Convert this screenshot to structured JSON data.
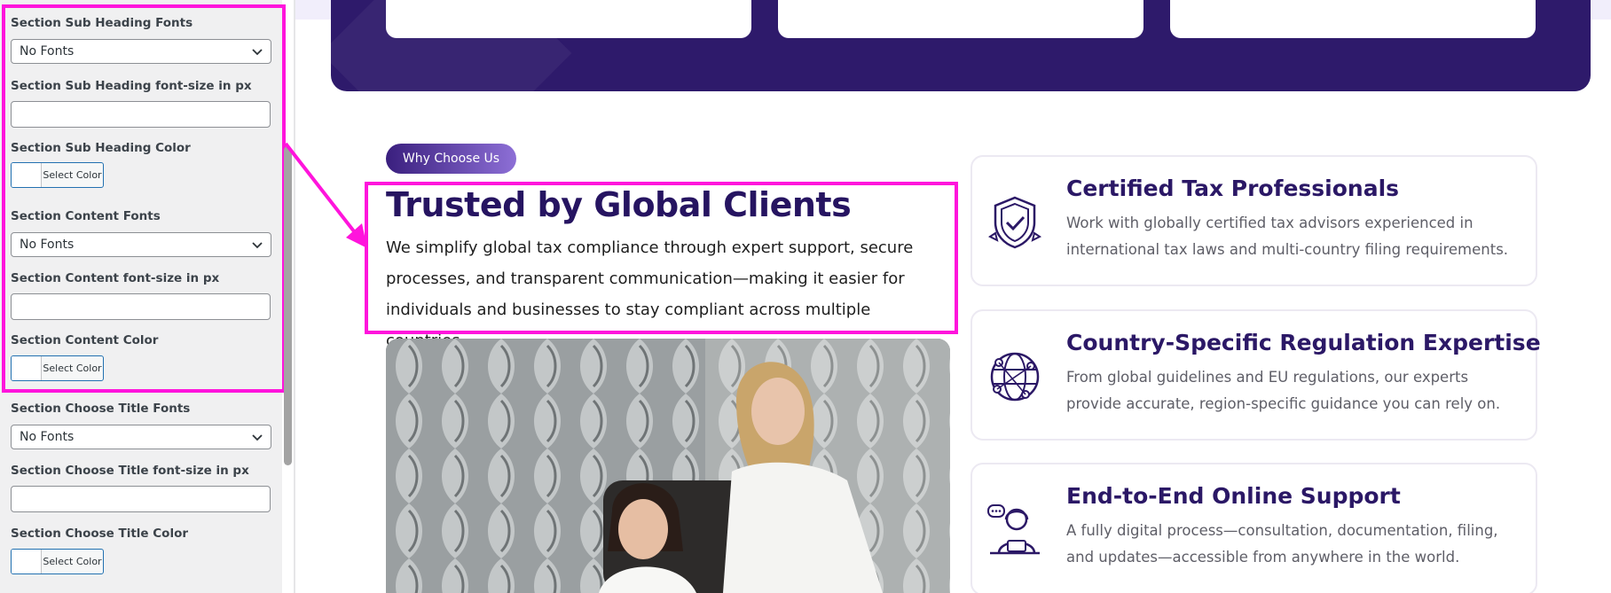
{
  "panel": {
    "fields": [
      {
        "label": "Section Sub Heading Fonts",
        "type": "select",
        "value": "No Fonts"
      },
      {
        "label": "Section Sub Heading font-size in px",
        "type": "input",
        "value": ""
      },
      {
        "label": "Section Sub Heading Color",
        "type": "color",
        "button": "Select Color"
      },
      {
        "label": "Section Content Fonts",
        "type": "select",
        "value": "No Fonts"
      },
      {
        "label": "Section Content font-size in px",
        "type": "input",
        "value": ""
      },
      {
        "label": "Section Content Color",
        "type": "color",
        "button": "Select Color"
      },
      {
        "label": "Section Choose Title Fonts",
        "type": "select",
        "value": "No Fonts"
      },
      {
        "label": "Section Choose Title font-size in px",
        "type": "input",
        "value": ""
      },
      {
        "label": "Section Choose Title Color",
        "type": "color",
        "button": "Select Color"
      }
    ]
  },
  "preview": {
    "badge": "Why Choose Us",
    "heading": "Trusted by Global Clients",
    "description": "We simplify global tax compliance through expert support, secure processes, and transparent communication—making it easier for individuals and businesses to stay compliant across multiple countries.",
    "features": [
      {
        "icon": "shield-check-icon",
        "title": "Certified Tax Professionals",
        "text": "Work with globally certified tax advisors experienced in international tax laws and multi-country filing requirements."
      },
      {
        "icon": "globe-network-icon",
        "title": "Country-Specific Regulation Expertise",
        "text": "From global guidelines and EU regulations, our experts provide accurate, region-specific guidance you can rely on."
      },
      {
        "icon": "online-support-agent-icon",
        "title": "End-to-End Online Support",
        "text": "A fully digital process—consultation, documentation, filing, and updates—accessible from anywhere in the world."
      }
    ]
  },
  "colors": {
    "highlight": "#ff14dc",
    "brand_dark": "#2e1a6b",
    "heading": "#261461"
  }
}
